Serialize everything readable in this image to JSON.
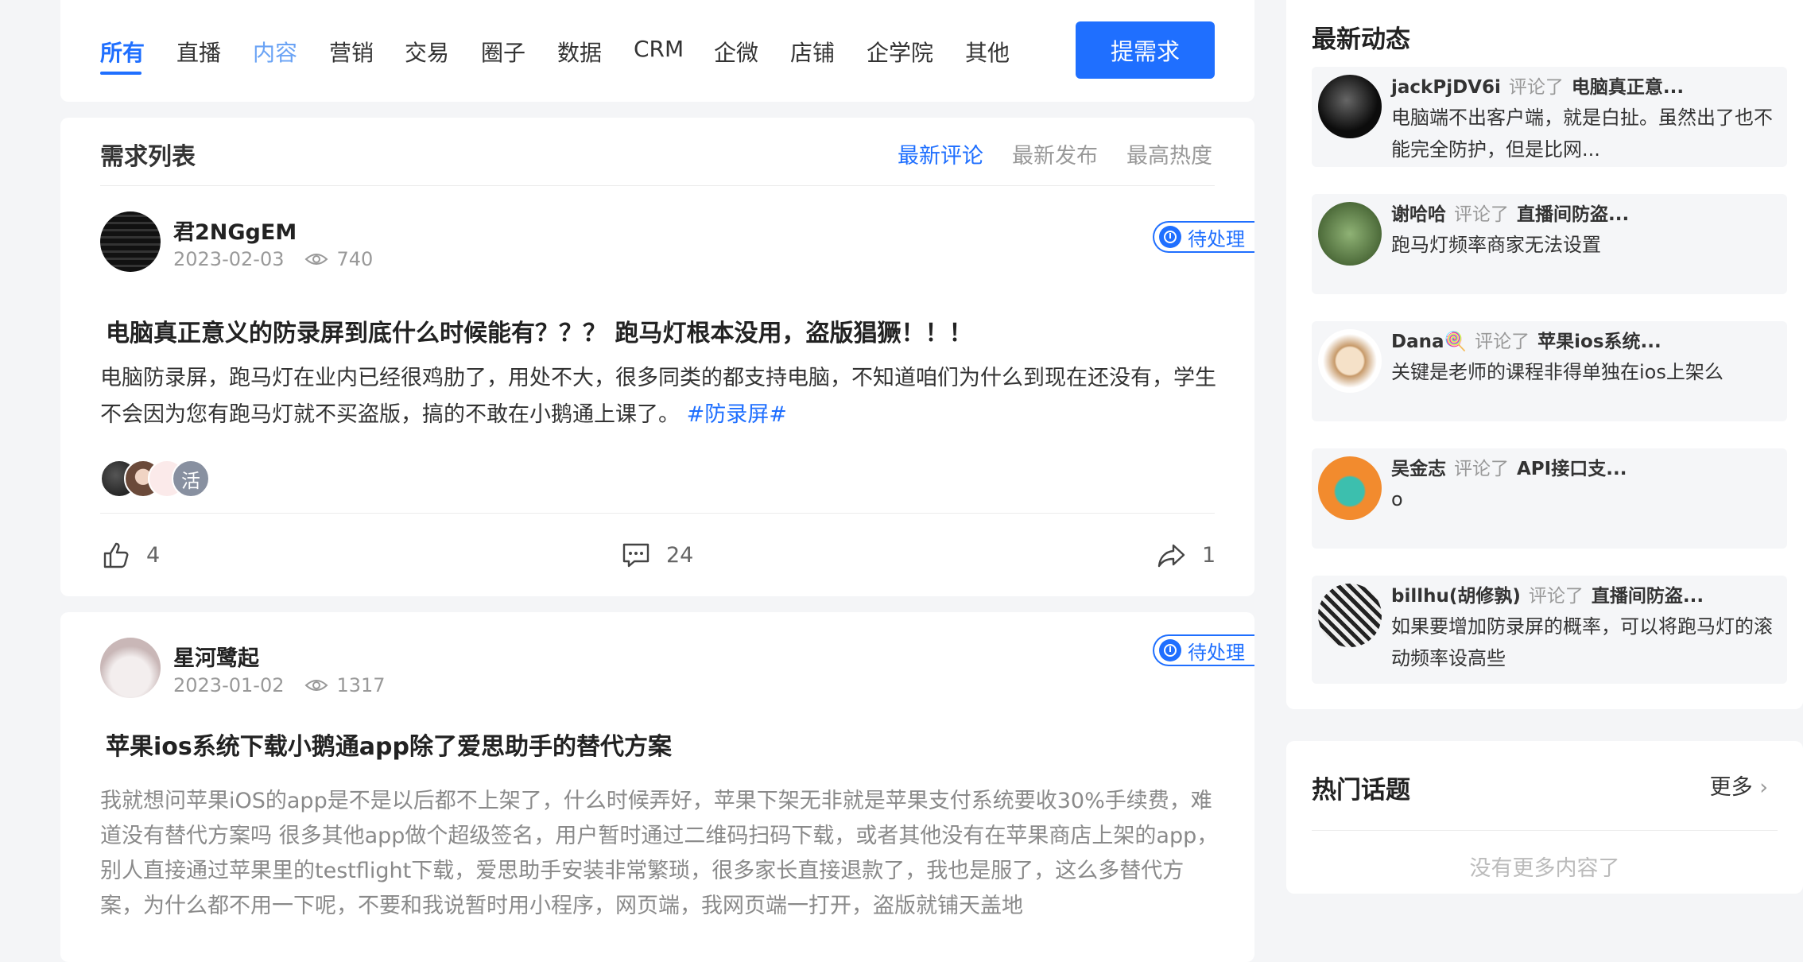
{
  "tabs": [
    "所有",
    "直播",
    "内容",
    "营销",
    "交易",
    "圈子",
    "数据",
    "CRM",
    "企微",
    "店铺",
    "企学院",
    "其他"
  ],
  "request_button": "提需求",
  "list": {
    "title": "需求列表",
    "sort_options": [
      "最新评论",
      "最新发布",
      "最高热度"
    ]
  },
  "posts": [
    {
      "author": "君2NGgEM",
      "date": "2023-02-03",
      "views": "740",
      "status": "待处理",
      "title": "电脑真正意义的防录屏到底什么时候能有？？？ 跑马灯根本没用，盗版猖獗！！！",
      "body": "电脑防录屏，跑马灯在业内已经很鸡肋了，用处不大，很多同类的都支持电脑，不知道咱们为什么到现在还没有，学生不会因为您有跑马灯就不买盗版，搞的不敢在小鹅通上课了。",
      "hashtag": "#防录屏#",
      "participant_more": "活",
      "likes": "4",
      "comments": "24",
      "shares": "1"
    },
    {
      "author": "星河鹭起",
      "date": "2023-01-02",
      "views": "1317",
      "status": "待处理",
      "title": "苹果ios系统下载小鹅通app除了爱思助手的替代方案",
      "body": "我就想问苹果iOS的app是不是以后都不上架了，什么时候弄好，苹果下架无非就是苹果支付系统要收30%手续费，难道没有替代方案吗 很多其他app做个超级签名，用户暂时通过二维码扫码下载，或者其他没有在苹果商店上架的app，别人直接通过苹果里的testflight下载，爱思助手安装非常繁琐，很多家长直接退款了，我也是服了，这么多替代方案，为什么都不用一下呢，不要和我说暂时用小程序，网页端，我网页端一打开，盗版就铺天盖地"
    }
  ],
  "activity": {
    "title": "最新动态",
    "verb": "评论了",
    "items": [
      {
        "user": "jackPjDV6i",
        "target": "电脑真正意...",
        "text": "电脑端不出客户端，就是白扯。虽然出了也不能完全防护，但是比网..."
      },
      {
        "user": "谢哈哈",
        "target": "直播间防盗...",
        "text": "跑马灯频率商家无法设置"
      },
      {
        "user": "Dana🍭",
        "target": "苹果ios系统...",
        "text": "关键是老师的课程非得单独在ios上架么"
      },
      {
        "user": "吴金志",
        "target": "API接口支...",
        "text": "o"
      },
      {
        "user": "billhu(胡修孰)",
        "target": "直播间防盗...",
        "text": "如果要增加防录屏的概率，可以将跑马灯的滚动频率设高些"
      }
    ]
  },
  "topics": {
    "title": "热门话题",
    "more": "更多",
    "empty": "没有更多内容了"
  },
  "colors": {
    "accent": "#1f6fff",
    "muted": "#999999",
    "background": "#f4f5f7"
  }
}
